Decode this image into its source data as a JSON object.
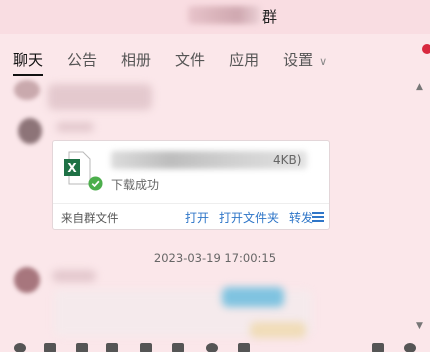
{
  "window": {
    "title_suffix": "群"
  },
  "tabs": [
    {
      "label": "聊天",
      "active": true
    },
    {
      "label": "公告",
      "active": false
    },
    {
      "label": "相册",
      "active": false
    },
    {
      "label": "文件",
      "active": false
    },
    {
      "label": "应用",
      "active": false
    },
    {
      "label": "设置",
      "active": false
    }
  ],
  "settings_chevron": "∨",
  "file_card": {
    "size_text": "4KB)",
    "status": "下载成功",
    "source": "来自群文件",
    "actions": {
      "open": "打开",
      "open_folder": "打开文件夹",
      "forward": "转发"
    },
    "file_type_letter": "X"
  },
  "timestamp": "2023-03-19 17:00:15",
  "colors": {
    "excel_green": "#1e7145",
    "success_green": "#4cae4c",
    "link_blue": "#2f76c8",
    "background": "#fbe7ea"
  }
}
